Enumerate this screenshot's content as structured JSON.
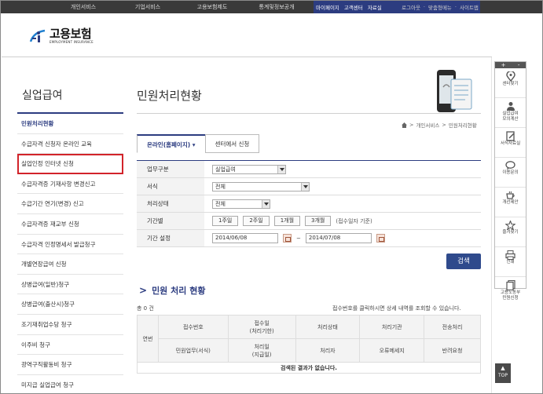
{
  "topnav": {
    "gnb": [
      "개인서비스",
      "기업서비스",
      "고용보험제도",
      "통계및정보공개"
    ],
    "util": [
      "마이페이지",
      "고객센터",
      "자료실"
    ],
    "util2": [
      "로그아웃",
      "·",
      "맞춤형메뉴",
      "·",
      "사이트맵"
    ]
  },
  "logo": {
    "ko": "고용보험",
    "en": "EMPLOYMENT INSURANCE"
  },
  "lnb": {
    "title": "실업급여",
    "items": [
      "민원처리현황",
      "수급자격 신청자 온라인 교육",
      "실업인정 인터넷 신청",
      "수급자격증 기재사항 변경신고",
      "수급기간 연기(변경) 신고",
      "수급자격증 재교부 신청",
      "수급자격 인정명세서 발급청구",
      "개별연장급여 신청",
      "상병급여(일반)청구",
      "상병급여(출산시)청구",
      "조기재취업수당 청구",
      "이주비 청구",
      "광역구직활동비 청구",
      "미지급 실업급여 청구"
    ]
  },
  "main": {
    "title": "민원처리현황",
    "breadcrumb": [
      "개인서비스",
      ">",
      "민원처리현황"
    ],
    "tabs": [
      "온라인(홈페이지)",
      "센터에서 신청"
    ],
    "tab_arrow": "▾",
    "form": {
      "business_label": "업무구분",
      "business_value": "실업급여",
      "form_label": "서식",
      "form_value": "전체",
      "status_label": "처리상태",
      "status_value": "전체",
      "period_label": "기간별",
      "period_buttons": [
        "1주일",
        "2주일",
        "1개월",
        "3개월"
      ],
      "period_note": "(접수일자 기준)",
      "range_label": "기간 설정",
      "date_from": "2014/06/08",
      "date_to": "2014/07/08",
      "range_sep": "~"
    },
    "search_label": "검색",
    "section_title": "민원 처리 현황",
    "section_chev": ">",
    "total": "총 0 건",
    "hint": "접수번호를 클릭하시면 상세 내역를 조회할 수 있습니다.",
    "grid": {
      "rownum": "연번",
      "h1": [
        "접수번호",
        "접수일\n(처리기한)",
        "처리상태",
        "처리기관",
        "전송처리"
      ],
      "h2": [
        "민원업무(서식)",
        "처리일\n(지급일)",
        "처리자",
        "오류메세지",
        "반려요청"
      ],
      "empty": "검색된 결과가 없습니다."
    }
  },
  "quick": {
    "head": [
      "+",
      "-"
    ],
    "items": [
      "센터찾기",
      "실업급여\n모의계산",
      "서식자료실",
      "이용문의",
      "개선제안",
      "즐겨찾기",
      "인쇄",
      "고용노동부\n민원신청"
    ]
  },
  "top_btn": {
    "arrow": "▲",
    "label": "TOP"
  },
  "colors": {
    "brand": "#2c3c80",
    "highlight": "#d2232a"
  }
}
